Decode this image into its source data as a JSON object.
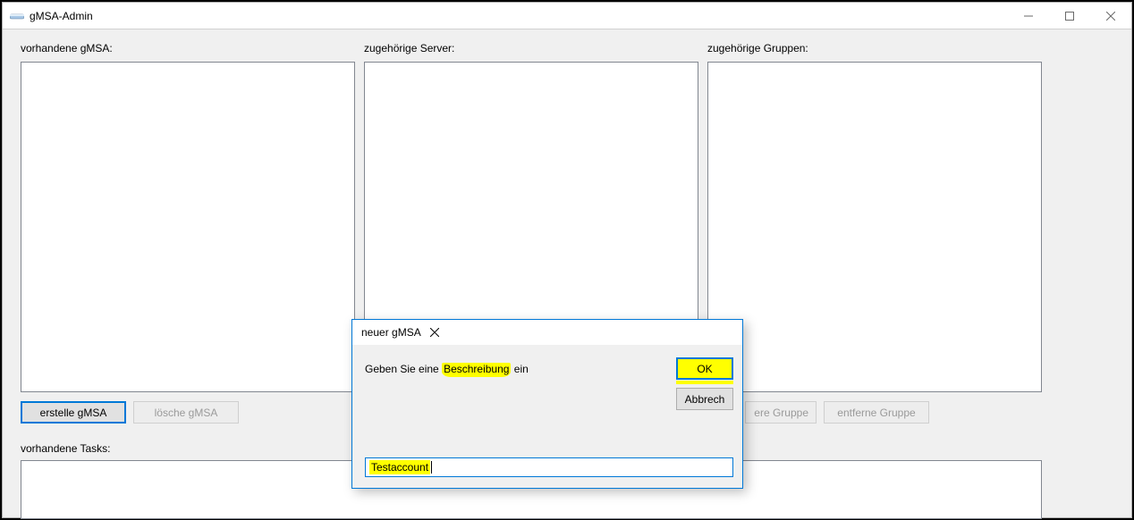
{
  "window": {
    "title": "gMSA-Admin"
  },
  "labels": {
    "existing_gmsa": "vorhandene gMSA:",
    "related_servers": "zugehörige Server:",
    "related_groups": "zugehörige Gruppen:",
    "existing_tasks": "vorhandene Tasks:"
  },
  "buttons": {
    "create_gmsa": "erstelle gMSA",
    "delete_gmsa": "lösche gMSA",
    "add_group": "ere Gruppe",
    "remove_group": "entferne Gruppe"
  },
  "dialog": {
    "title": "neuer gMSA",
    "prompt_pre": "Geben Sie eine ",
    "prompt_hl": "Beschreibung",
    "prompt_post": " ein",
    "ok": "OK",
    "cancel": "Abbrech",
    "input_value": "Testaccount"
  }
}
